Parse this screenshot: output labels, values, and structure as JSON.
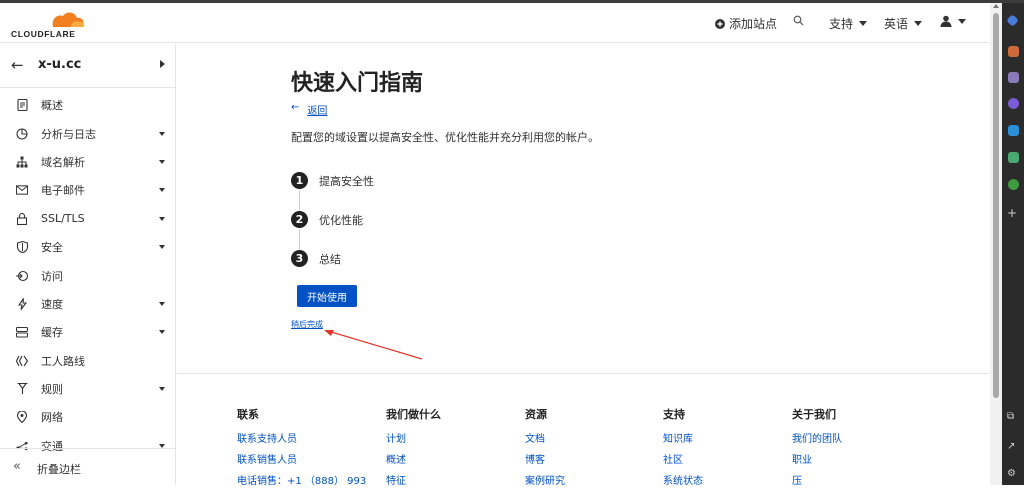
{
  "header": {
    "logo_text": "CLOUDFLARE",
    "add_site": "添加站点",
    "support": "支持",
    "language": "英语"
  },
  "sidebar": {
    "domain": "x-u.cc",
    "items": [
      {
        "label": "概述",
        "icon": "document-icon",
        "has_caret": false
      },
      {
        "label": "分析与日志",
        "icon": "chart-pie-icon",
        "has_caret": true
      },
      {
        "label": "域名解析",
        "icon": "network-icon",
        "has_caret": true
      },
      {
        "label": "电子邮件",
        "icon": "email-icon",
        "has_caret": true
      },
      {
        "label": "SSL/TLS",
        "icon": "lock-icon",
        "has_caret": true
      },
      {
        "label": "安全",
        "icon": "shield-icon",
        "has_caret": true
      },
      {
        "label": "访问",
        "icon": "access-icon",
        "has_caret": false
      },
      {
        "label": "速度",
        "icon": "lightning-icon",
        "has_caret": true
      },
      {
        "label": "缓存",
        "icon": "cache-icon",
        "has_caret": true
      },
      {
        "label": "工人路线",
        "icon": "workers-icon",
        "has_caret": false
      },
      {
        "label": "规则",
        "icon": "rules-icon",
        "has_caret": true
      },
      {
        "label": "网络",
        "icon": "location-icon",
        "has_caret": false
      },
      {
        "label": "交通",
        "icon": "traffic-icon",
        "has_caret": true
      }
    ],
    "collapse_label": "折叠边栏"
  },
  "main": {
    "title": "快速入门指南",
    "back_label": "返回",
    "description": "配置您的域设置以提高安全性、优化性能并充分利用您的帐户。",
    "steps": [
      {
        "num": "1",
        "label": "提高安全性"
      },
      {
        "num": "2",
        "label": "优化性能"
      },
      {
        "num": "3",
        "label": "总结"
      }
    ],
    "start_button": "开始使用",
    "later_link": "稍后完成"
  },
  "footer": {
    "columns": [
      {
        "heading": "联系",
        "links": [
          "联系支持人员",
          "联系销售人员",
          "电话销售：+1 （888） 993"
        ]
      },
      {
        "heading": "我们做什么",
        "links": [
          "计划",
          "概述",
          "特征"
        ]
      },
      {
        "heading": "资源",
        "links": [
          "文档",
          "博客",
          "案例研究"
        ]
      },
      {
        "heading": "支持",
        "links": [
          "知识库",
          "社区",
          "系统状态"
        ]
      },
      {
        "heading": "关于我们",
        "links": [
          "我们的团队",
          "职业",
          "压"
        ]
      }
    ]
  },
  "colors": {
    "accent": "#0051c3",
    "logo_orange": "#f38020",
    "annotation_red": "#e0352b"
  }
}
